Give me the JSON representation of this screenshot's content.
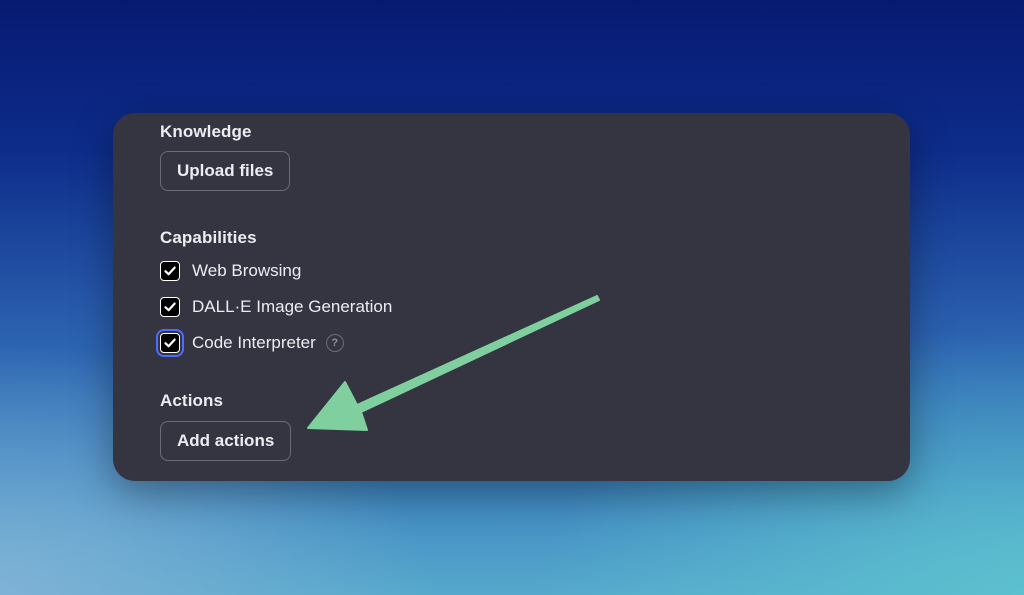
{
  "knowledge": {
    "title": "Knowledge",
    "upload_label": "Upload files"
  },
  "capabilities": {
    "title": "Capabilities",
    "items": [
      {
        "label": "Web Browsing",
        "checked": true
      },
      {
        "label": "DALL·E Image Generation",
        "checked": true
      },
      {
        "label": "Code Interpreter",
        "checked": true,
        "help": "?"
      }
    ]
  },
  "actions": {
    "title": "Actions",
    "add_label": "Add actions"
  },
  "colors": {
    "panel": "#343541",
    "text": "#ececf1",
    "border": "#6b6c7b",
    "focus_ring": "#4d6bff",
    "annotation_arrow": "#7fcf9f"
  },
  "icons": {
    "checkbox": "check-icon",
    "help": "question-mark-icon",
    "annotation": "arrow-icon"
  }
}
